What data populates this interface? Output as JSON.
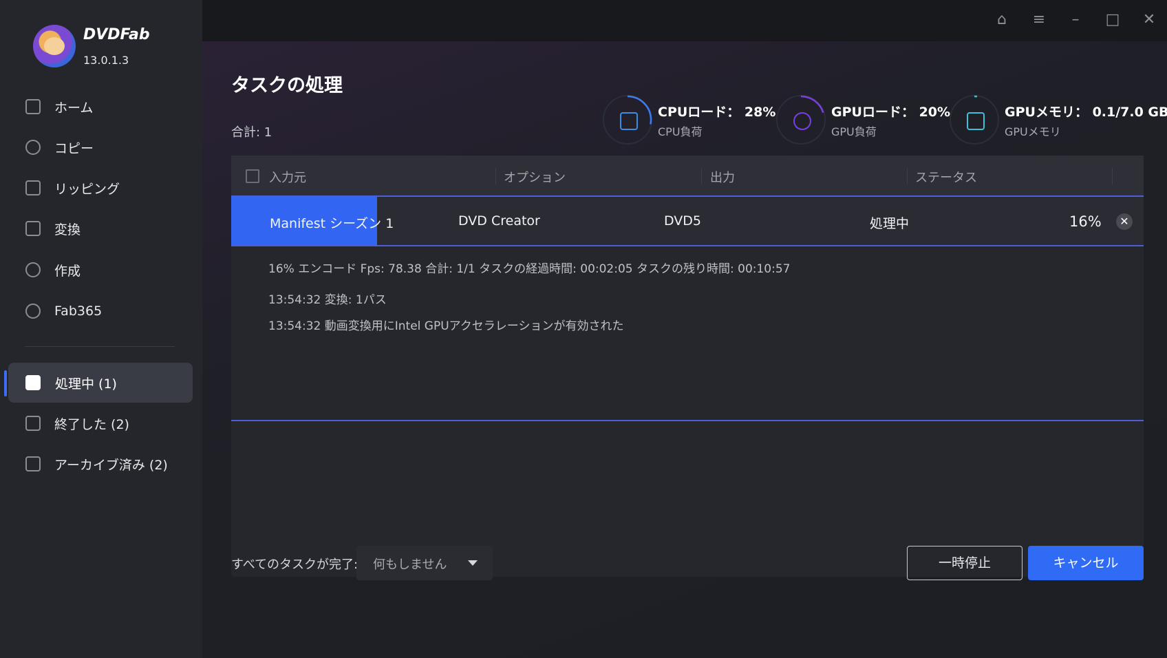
{
  "app": {
    "brand": "DVDFab",
    "version": "13.0.1.3"
  },
  "sidebar": {
    "items": [
      {
        "label": "ホーム",
        "icon": "home-icon"
      },
      {
        "label": "コピー",
        "icon": "copy-icon"
      },
      {
        "label": "リッピング",
        "icon": "ripper-icon"
      },
      {
        "label": "変換",
        "icon": "converter-icon"
      },
      {
        "label": "作成",
        "icon": "creator-icon"
      },
      {
        "label": "Fab365",
        "icon": "fab365-icon"
      }
    ],
    "queue": [
      {
        "label": "処理中 (1)",
        "icon": "processing-icon",
        "active": true
      },
      {
        "label": "終了した (2)",
        "icon": "finished-icon"
      },
      {
        "label": "アーカイブ済み (2)",
        "icon": "archive-icon"
      }
    ]
  },
  "titlebar": {
    "icons": [
      "skin-icon",
      "menu-icon",
      "minimize-icon",
      "maximize-icon",
      "close-icon"
    ]
  },
  "main": {
    "title": "タスクの処理",
    "total": "合計: 1",
    "stats": [
      {
        "main": "CPUロード： 28%",
        "sub": "CPU負荷",
        "icon": "cpu-icon",
        "value": 0.28
      },
      {
        "main": "GPUロード： 20%",
        "sub": "GPU負荷",
        "icon": "intel-gpu-icon",
        "value": 0.2
      },
      {
        "main": "GPUメモリ： 0.1/7.0 GB",
        "sub": "GPUメモリ",
        "icon": "gpu-memory-icon",
        "value": 0.014
      }
    ],
    "table": {
      "headers": [
        "入力元",
        "オプション",
        "出力",
        "ステータス"
      ],
      "row": {
        "source": "Manifest シーズン 1",
        "option": "DVD Creator",
        "output": "DVD5",
        "status": "処理中",
        "percent": "16%",
        "progress": 0.16
      },
      "log": [
        "16%  エンコード Fps: 78.38   合計: 1/1  タスクの経過時間: 00:02:05  タスクの残り時間: 00:10:57",
        "13:54:32  変換: 1パス",
        "13:54:32  動画変換用にIntel GPUアクセラレーションが有効された"
      ]
    }
  },
  "footer": {
    "label": "すべてのタスクが完了:",
    "select_value": "何もしません",
    "pause": "一時停止",
    "cancel": "キャンセル"
  },
  "colors": {
    "accent": "#2f6bf5",
    "progress": "#3266f2",
    "sidebar_bg": "#25262c",
    "main_bg": "#1e1f24"
  }
}
